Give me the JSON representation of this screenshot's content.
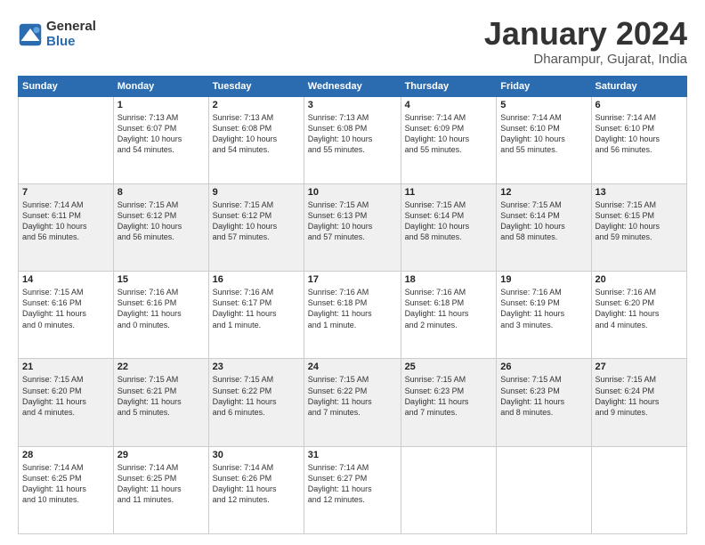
{
  "logo": {
    "general": "General",
    "blue": "Blue"
  },
  "header": {
    "month": "January 2024",
    "location": "Dharampur, Gujarat, India"
  },
  "weekdays": [
    "Sunday",
    "Monday",
    "Tuesday",
    "Wednesday",
    "Thursday",
    "Friday",
    "Saturday"
  ],
  "weeks": [
    [
      {
        "day": "",
        "info": ""
      },
      {
        "day": "1",
        "info": "Sunrise: 7:13 AM\nSunset: 6:07 PM\nDaylight: 10 hours\nand 54 minutes."
      },
      {
        "day": "2",
        "info": "Sunrise: 7:13 AM\nSunset: 6:08 PM\nDaylight: 10 hours\nand 54 minutes."
      },
      {
        "day": "3",
        "info": "Sunrise: 7:13 AM\nSunset: 6:08 PM\nDaylight: 10 hours\nand 55 minutes."
      },
      {
        "day": "4",
        "info": "Sunrise: 7:14 AM\nSunset: 6:09 PM\nDaylight: 10 hours\nand 55 minutes."
      },
      {
        "day": "5",
        "info": "Sunrise: 7:14 AM\nSunset: 6:10 PM\nDaylight: 10 hours\nand 55 minutes."
      },
      {
        "day": "6",
        "info": "Sunrise: 7:14 AM\nSunset: 6:10 PM\nDaylight: 10 hours\nand 56 minutes."
      }
    ],
    [
      {
        "day": "7",
        "info": "Sunrise: 7:14 AM\nSunset: 6:11 PM\nDaylight: 10 hours\nand 56 minutes."
      },
      {
        "day": "8",
        "info": "Sunrise: 7:15 AM\nSunset: 6:12 PM\nDaylight: 10 hours\nand 56 minutes."
      },
      {
        "day": "9",
        "info": "Sunrise: 7:15 AM\nSunset: 6:12 PM\nDaylight: 10 hours\nand 57 minutes."
      },
      {
        "day": "10",
        "info": "Sunrise: 7:15 AM\nSunset: 6:13 PM\nDaylight: 10 hours\nand 57 minutes."
      },
      {
        "day": "11",
        "info": "Sunrise: 7:15 AM\nSunset: 6:14 PM\nDaylight: 10 hours\nand 58 minutes."
      },
      {
        "day": "12",
        "info": "Sunrise: 7:15 AM\nSunset: 6:14 PM\nDaylight: 10 hours\nand 58 minutes."
      },
      {
        "day": "13",
        "info": "Sunrise: 7:15 AM\nSunset: 6:15 PM\nDaylight: 10 hours\nand 59 minutes."
      }
    ],
    [
      {
        "day": "14",
        "info": "Sunrise: 7:15 AM\nSunset: 6:16 PM\nDaylight: 11 hours\nand 0 minutes."
      },
      {
        "day": "15",
        "info": "Sunrise: 7:16 AM\nSunset: 6:16 PM\nDaylight: 11 hours\nand 0 minutes."
      },
      {
        "day": "16",
        "info": "Sunrise: 7:16 AM\nSunset: 6:17 PM\nDaylight: 11 hours\nand 1 minute."
      },
      {
        "day": "17",
        "info": "Sunrise: 7:16 AM\nSunset: 6:18 PM\nDaylight: 11 hours\nand 1 minute."
      },
      {
        "day": "18",
        "info": "Sunrise: 7:16 AM\nSunset: 6:18 PM\nDaylight: 11 hours\nand 2 minutes."
      },
      {
        "day": "19",
        "info": "Sunrise: 7:16 AM\nSunset: 6:19 PM\nDaylight: 11 hours\nand 3 minutes."
      },
      {
        "day": "20",
        "info": "Sunrise: 7:16 AM\nSunset: 6:20 PM\nDaylight: 11 hours\nand 4 minutes."
      }
    ],
    [
      {
        "day": "21",
        "info": "Sunrise: 7:15 AM\nSunset: 6:20 PM\nDaylight: 11 hours\nand 4 minutes."
      },
      {
        "day": "22",
        "info": "Sunrise: 7:15 AM\nSunset: 6:21 PM\nDaylight: 11 hours\nand 5 minutes."
      },
      {
        "day": "23",
        "info": "Sunrise: 7:15 AM\nSunset: 6:22 PM\nDaylight: 11 hours\nand 6 minutes."
      },
      {
        "day": "24",
        "info": "Sunrise: 7:15 AM\nSunset: 6:22 PM\nDaylight: 11 hours\nand 7 minutes."
      },
      {
        "day": "25",
        "info": "Sunrise: 7:15 AM\nSunset: 6:23 PM\nDaylight: 11 hours\nand 7 minutes."
      },
      {
        "day": "26",
        "info": "Sunrise: 7:15 AM\nSunset: 6:23 PM\nDaylight: 11 hours\nand 8 minutes."
      },
      {
        "day": "27",
        "info": "Sunrise: 7:15 AM\nSunset: 6:24 PM\nDaylight: 11 hours\nand 9 minutes."
      }
    ],
    [
      {
        "day": "28",
        "info": "Sunrise: 7:14 AM\nSunset: 6:25 PM\nDaylight: 11 hours\nand 10 minutes."
      },
      {
        "day": "29",
        "info": "Sunrise: 7:14 AM\nSunset: 6:25 PM\nDaylight: 11 hours\nand 11 minutes."
      },
      {
        "day": "30",
        "info": "Sunrise: 7:14 AM\nSunset: 6:26 PM\nDaylight: 11 hours\nand 12 minutes."
      },
      {
        "day": "31",
        "info": "Sunrise: 7:14 AM\nSunset: 6:27 PM\nDaylight: 11 hours\nand 12 minutes."
      },
      {
        "day": "",
        "info": ""
      },
      {
        "day": "",
        "info": ""
      },
      {
        "day": "",
        "info": ""
      }
    ]
  ]
}
